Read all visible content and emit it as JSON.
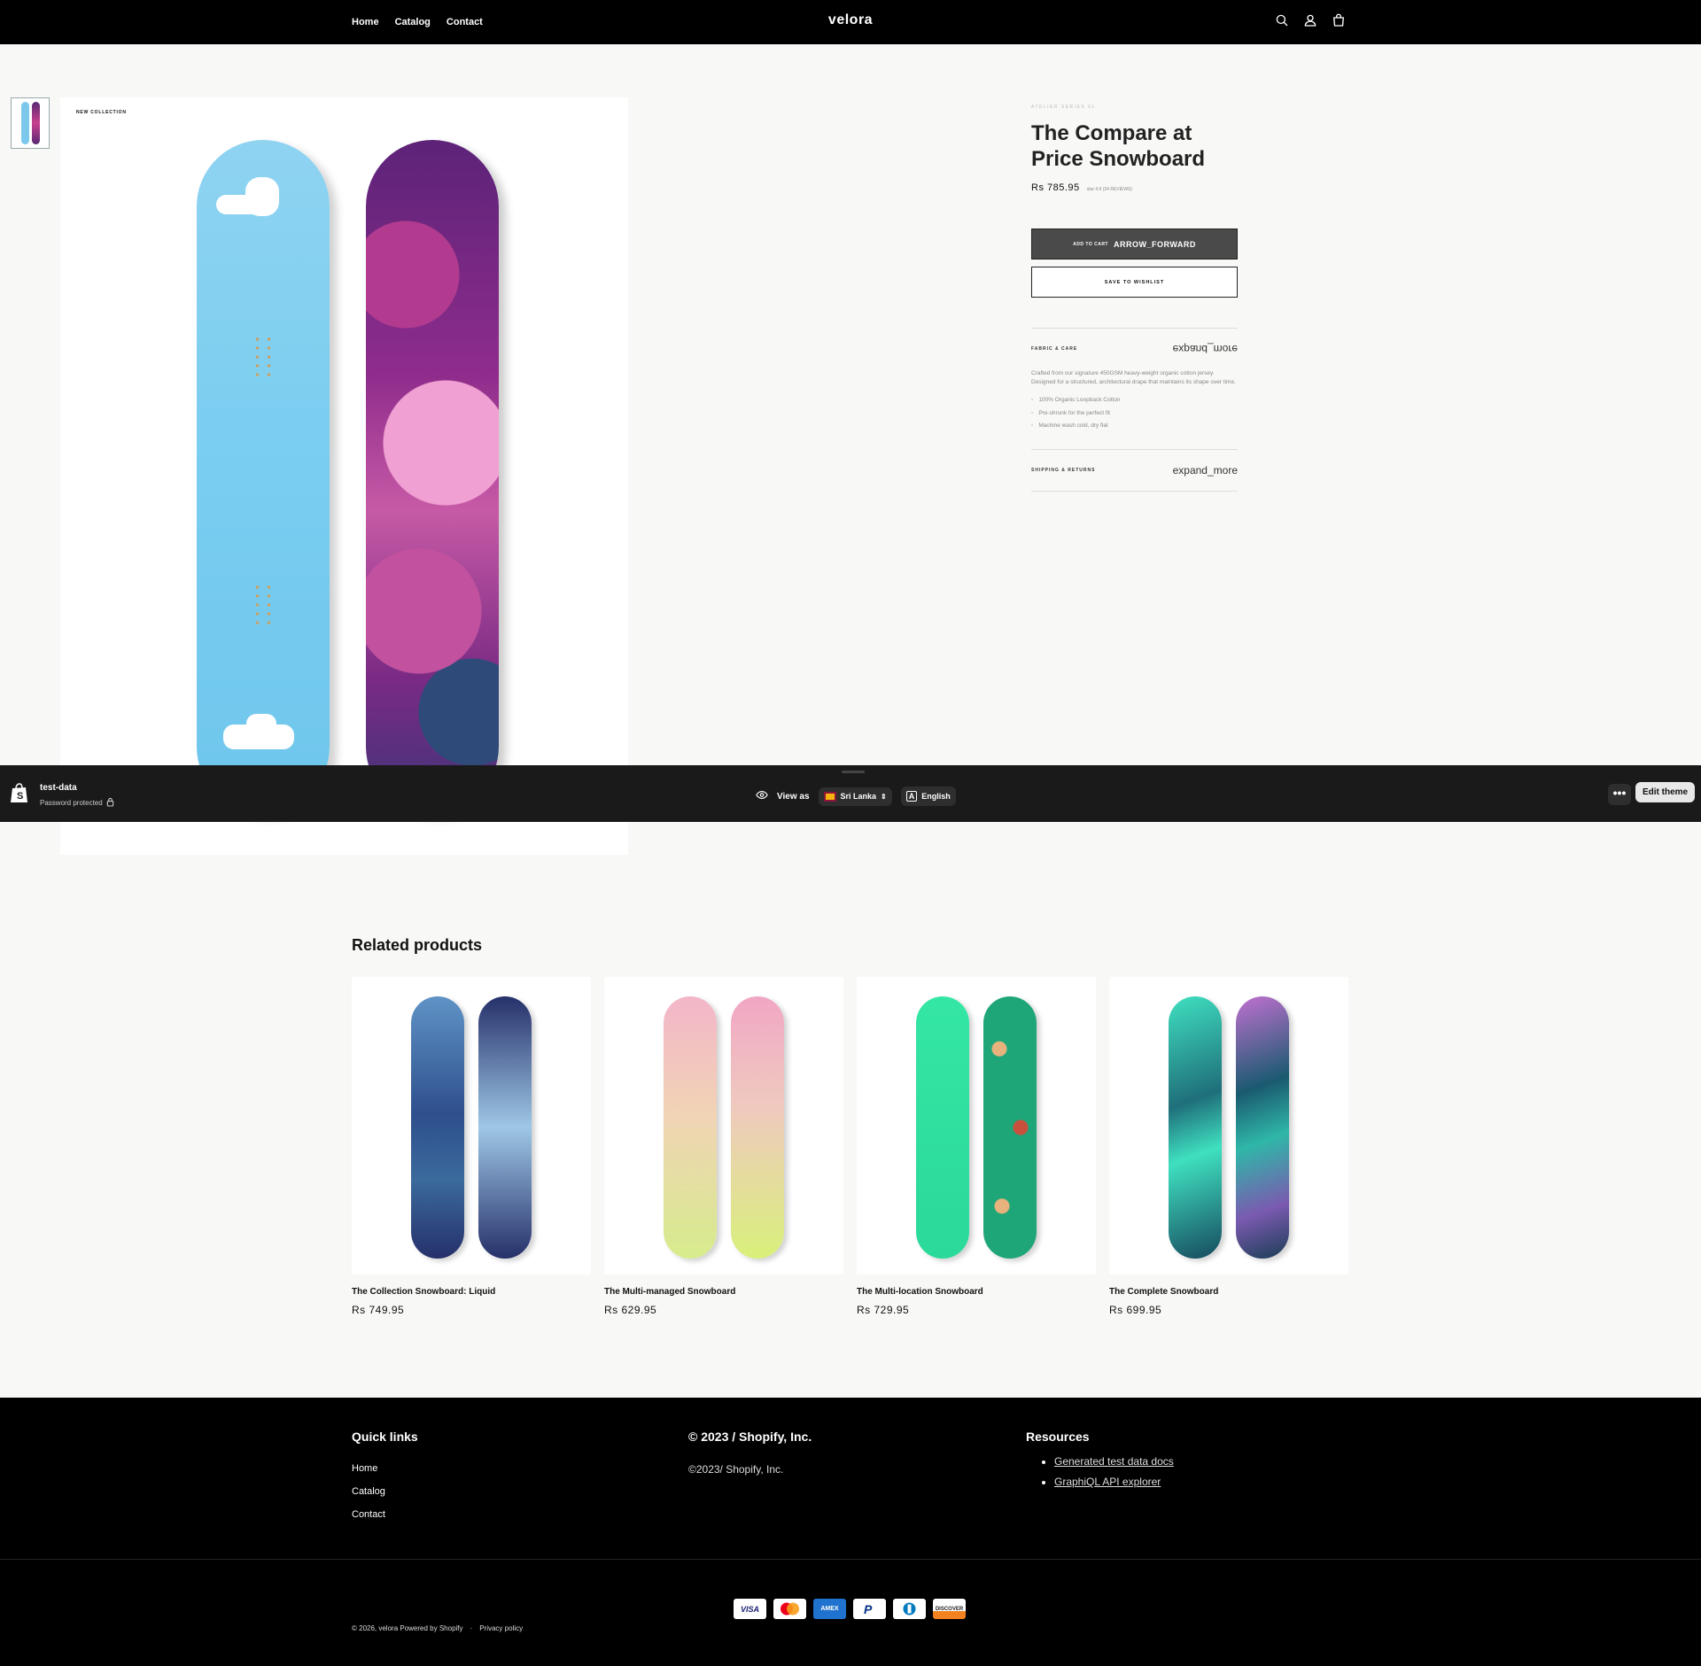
{
  "header": {
    "nav": [
      "Home",
      "Catalog",
      "Contact"
    ],
    "logo": "velora",
    "icons": [
      "search-icon",
      "account-icon",
      "cart-icon"
    ]
  },
  "gallery": {
    "tag": "NEW COLLECTION"
  },
  "product": {
    "collection": "ATELIER SERIES 01",
    "title": "The Compare at Price Snowboard",
    "price": "Rs 785.95",
    "rating": "star 4.9 (24 REVIEWS)",
    "add_to_cart_label": "ADD TO CART",
    "add_to_cart_icon_text": "ARROW_FORWARD",
    "wishlist_label": "SAVE TO WISHLIST",
    "accordion": [
      {
        "title": "FABRIC & CARE",
        "icon_text": "expand_more",
        "body": "Crafted from our signature 450GSM heavy-weight organic cotton jersey. Designed for a structured, architectural drape that maintains its shape over time.",
        "bullets": [
          "100% Organic Loopback Cotton",
          "Pre-shrunk for the perfect fit",
          "Machine wash cold, dry flat"
        ]
      },
      {
        "title": "SHIPPING & RETURNS",
        "icon_text": "expand_more"
      }
    ]
  },
  "preview_bar": {
    "store": "test-data",
    "status": "Password protected",
    "view_as": "View as",
    "country": "Sri Lanka",
    "language": "English",
    "more": "•••",
    "edit_theme": "Edit theme"
  },
  "related": {
    "title": "Related products",
    "items": [
      {
        "name": "The Collection Snowboard: Liquid",
        "price": "Rs 749.95"
      },
      {
        "name": "The Multi-managed Snowboard",
        "price": "Rs 629.95"
      },
      {
        "name": "The Multi-location Snowboard",
        "price": "Rs 729.95"
      },
      {
        "name": "The Complete Snowboard",
        "price": "Rs 699.95"
      }
    ]
  },
  "footer": {
    "quick_links_title": "Quick links",
    "quick_links": [
      "Home",
      "Catalog",
      "Contact"
    ],
    "company_title": "© 2023 / Shopify, Inc.",
    "company_text": "©2023/ Shopify, Inc.",
    "resources_title": "Resources",
    "resources": [
      "Generated test data docs",
      "GraphiQL API explorer"
    ],
    "payment_methods": [
      "VISA",
      "Mastercard",
      "AMEX",
      "PayPal",
      "Diners",
      "DISCOVER"
    ],
    "copyright": "© 2026, velora Powered by Shopify",
    "privacy": "Privacy policy"
  },
  "colors": {
    "header_bg": "#000000",
    "page_bg": "#f8f8f6",
    "cart_button": "#4a4a4a",
    "preview_bar_bg": "#1a1a1a"
  }
}
